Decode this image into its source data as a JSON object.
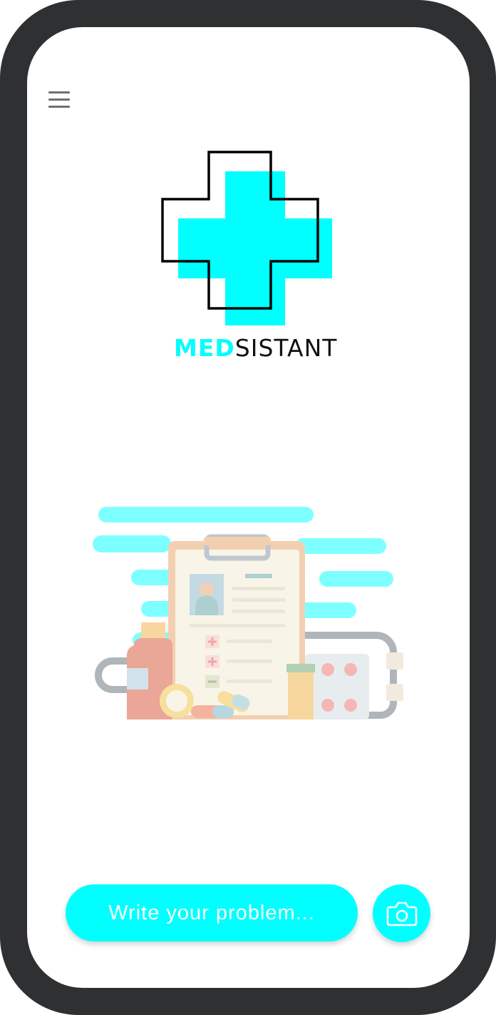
{
  "header": {
    "menu_icon": "hamburger-menu-icon"
  },
  "logo": {
    "icon": "medical-cross-icon",
    "brand_part1": "MED",
    "brand_part2": "SISTANT",
    "accent_color": "#00ffff"
  },
  "illustration": {
    "icon": "medical-clipboard-illustration"
  },
  "composer": {
    "placeholder": "Write your problem...",
    "camera_icon": "camera-icon",
    "accent_color": "#00ffff"
  },
  "theme": {
    "frame_color": "#2f3032",
    "background": "#ffffff"
  }
}
